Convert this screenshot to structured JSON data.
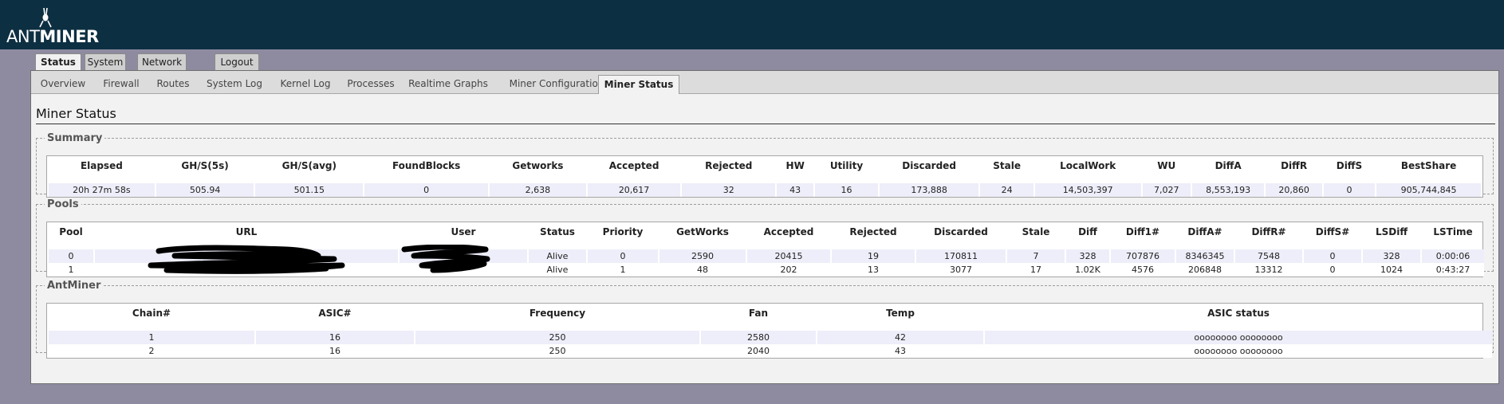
{
  "brand": {
    "prefix": "ANT",
    "suffix": "MINER"
  },
  "main_tabs": [
    {
      "label": "Status",
      "active": true
    },
    {
      "label": "System",
      "active": false
    },
    {
      "label": "Network",
      "active": false
    },
    {
      "label": "Logout",
      "active": false
    }
  ],
  "sub_tabs": [
    {
      "label": "Overview"
    },
    {
      "label": "Firewall"
    },
    {
      "label": "Routes"
    },
    {
      "label": "System Log"
    },
    {
      "label": "Kernel Log"
    },
    {
      "label": "Processes"
    },
    {
      "label": "Realtime Graphs"
    },
    {
      "label": "Miner Configuration"
    },
    {
      "label": "Miner Status",
      "active": true
    }
  ],
  "page_title": "Miner Status",
  "summary": {
    "legend": "Summary",
    "headers": [
      "Elapsed",
      "GH/S(5s)",
      "GH/S(avg)",
      "FoundBlocks",
      "Getworks",
      "Accepted",
      "Rejected",
      "HW",
      "Utility",
      "Discarded",
      "Stale",
      "LocalWork",
      "WU",
      "DiffA",
      "DiffR",
      "DiffS",
      "BestShare"
    ],
    "row": [
      "20h 27m 58s",
      "505.94",
      "501.15",
      "0",
      "2,638",
      "20,617",
      "32",
      "43",
      "16",
      "173,888",
      "24",
      "14,503,397",
      "7,027",
      "8,553,193",
      "20,860",
      "0",
      "905,744,845"
    ]
  },
  "pools": {
    "legend": "Pools",
    "headers": [
      "Pool",
      "URL",
      "User",
      "Status",
      "Priority",
      "GetWorks",
      "Accepted",
      "Rejected",
      "Discarded",
      "Stale",
      "Diff",
      "Diff1#",
      "DiffA#",
      "DiffR#",
      "DiffS#",
      "LSDiff",
      "LSTime"
    ],
    "rows": [
      [
        "0",
        "",
        "",
        "Alive",
        "0",
        "2590",
        "20415",
        "19",
        "170811",
        "7",
        "328",
        "707876",
        "8346345",
        "7548",
        "0",
        "328",
        "0:00:06"
      ],
      [
        "1",
        "",
        "",
        "Alive",
        "1",
        "48",
        "202",
        "13",
        "3077",
        "17",
        "1.02K",
        "4576",
        "206848",
        "13312",
        "0",
        "1024",
        "0:43:27"
      ]
    ]
  },
  "antminer": {
    "legend": "AntMiner",
    "headers": [
      "Chain#",
      "ASIC#",
      "Frequency",
      "Fan",
      "Temp",
      "ASIC status"
    ],
    "rows": [
      [
        "1",
        "16",
        "250",
        "2580",
        "42",
        "oooooooo oooooooo"
      ],
      [
        "2",
        "16",
        "250",
        "2040",
        "43",
        "oooooooo oooooooo"
      ]
    ]
  }
}
